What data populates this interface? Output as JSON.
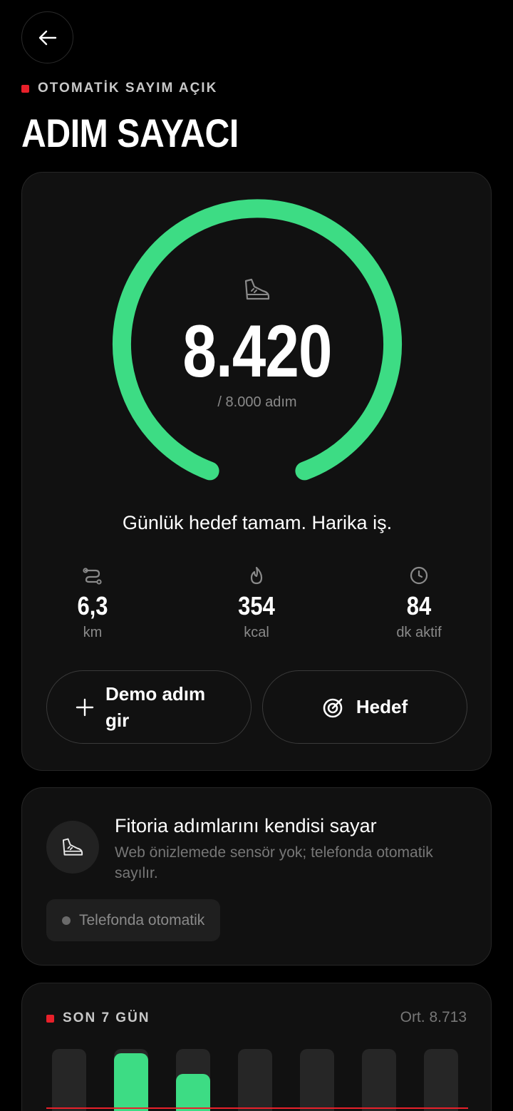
{
  "header": {
    "status_label": "OTOMATİK SAYIM AÇIK",
    "title": "ADIM SAYACI"
  },
  "progress": {
    "steps": "8.420",
    "goal_label": "/ 8.000 adım",
    "steps_value": 8420,
    "goal_value": 8000,
    "ring_color": "#3ddc84",
    "message": "Günlük hedef tamam. Harika iş."
  },
  "stats": [
    {
      "icon": "route-icon",
      "value": "6,3",
      "unit": "km"
    },
    {
      "icon": "flame-icon",
      "value": "354",
      "unit": "kcal"
    },
    {
      "icon": "clock-icon",
      "value": "84",
      "unit": "dk aktif"
    }
  ],
  "actions": {
    "demo_label": "Demo adım gir",
    "goal_label": "Hedef"
  },
  "info": {
    "title": "Fitoria adımlarını kendisi sayar",
    "description": "Web önizlemede sensör yok; telefonda otomatik sayılır.",
    "chip_label": "Telefonda otomatik"
  },
  "week": {
    "label": "SON 7 GÜN",
    "average": "Ort. 8.713",
    "goal_steps": 8000,
    "accent": "#e8202a",
    "bars": [
      {
        "level": 0.0
      },
      {
        "level": 0.96
      },
      {
        "level": 0.78
      },
      {
        "level": 0.42
      },
      {
        "level": 0.06,
        "muted": true
      },
      {
        "level": 0.0
      },
      {
        "level": 0.1
      }
    ]
  }
}
